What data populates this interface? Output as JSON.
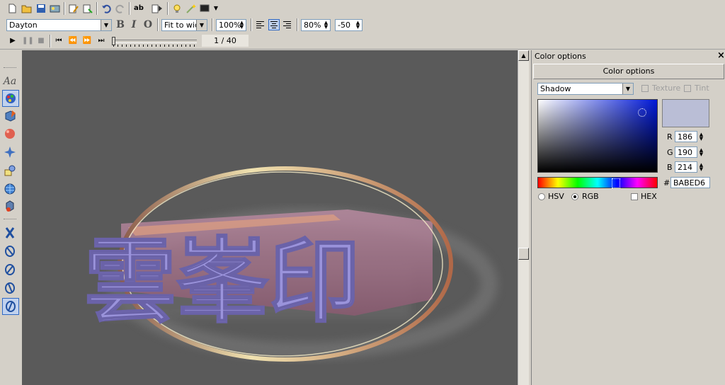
{
  "toolbar": {
    "font_name": "Dayton",
    "bold": "B",
    "italic": "I",
    "outline": "O",
    "fit_mode": "Fit to widt",
    "zoom": "100%",
    "scale": "80%",
    "offset": "-50",
    "frame_counter": "1 / 40"
  },
  "sidebar": {
    "text_tool": "Aa"
  },
  "canvas": {
    "headline": "雲峯印",
    "background_color": "#5a5a5a",
    "text_color": "#9a93db",
    "ring_color": "#e8d9a0"
  },
  "panel": {
    "title": "Color options",
    "section_header": "Color options",
    "target_select": "Shadow",
    "texture_label": "Texture",
    "tint_label": "Tint",
    "r_label": "R",
    "r_value": "186",
    "g_label": "G",
    "g_value": "190",
    "b_label": "B",
    "b_value": "214",
    "hex_prefix": "#",
    "hex_value": "BABED6",
    "mode_hsv": "HSV",
    "mode_rgb": "RGB",
    "mode_hex": "HEX",
    "swatch_color": "#babed6"
  }
}
